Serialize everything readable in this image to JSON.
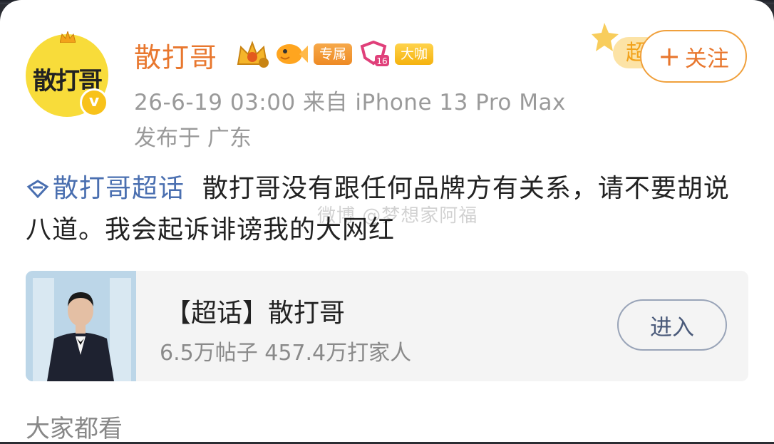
{
  "user": {
    "name": "散打哥",
    "avatar_text": "散打哥",
    "verified_mark": "v",
    "badges": {
      "tag1": "专属",
      "tag2": "大咖",
      "level_number": "16"
    }
  },
  "post_meta": {
    "time_source": "26-6-19 03:00  来自 iPhone 13 Pro Max",
    "location": "发布于 广东"
  },
  "follow_button": {
    "plus": "+",
    "label": "关注"
  },
  "supertopic_deco_text": "超",
  "post": {
    "topic_link": "散打哥超话",
    "text": "散打哥没有跟任何品牌方有关系，请不要胡说八道。我会起诉诽谤我的大网红"
  },
  "watermark": "微博 @梦想家阿福",
  "topic_card": {
    "title": "【超话】散打哥",
    "stats": "6.5万帖子 457.4万打家人",
    "enter_label": "进入"
  },
  "cutoff_text": "大家都看",
  "colors": {
    "name": "#e8772e",
    "link": "#4a6fb0",
    "meta": "#9a9a9a"
  }
}
